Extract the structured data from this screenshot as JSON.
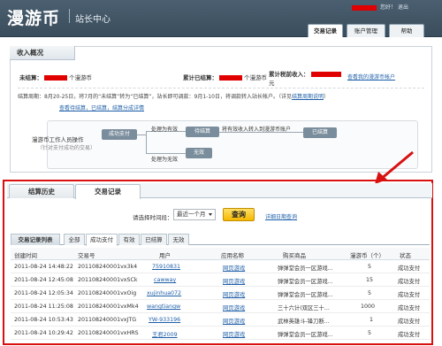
{
  "header": {
    "logo": "漫游币",
    "subtitle": "站长中心",
    "user_greeting": "您好！",
    "exit": "退出",
    "nav": [
      {
        "label": "交易记录",
        "active": true
      },
      {
        "label": "账户管理",
        "active": false
      },
      {
        "label": "帮助",
        "active": false
      }
    ]
  },
  "earnings": {
    "panel_title": "收入概况",
    "unsettled_label": "未结算：",
    "unsettled_unit": "个漫游币",
    "total_settled_label": "累计已结算：",
    "total_settled_unit": "个漫游币",
    "pretax_label": "累计税前收入：",
    "pretax_unit": "元",
    "my_account_link": "查看我的漫游币帐户",
    "note_line1": "结算周期：8月20-25日，将7月的“未结算”转为“已结算”，站长即可调款：9月1-10日，将调款转入站长帐户。（详见",
    "note_link1": "结算周期说明",
    "note_line1_end": "）",
    "note_link2": "查看待结算，已结算，结算分成详情"
  },
  "flow": {
    "operator_label": "漫游币工作人员操作",
    "operator_sub": "（针对支付成功的交易）",
    "box_success": "成功支付",
    "box_pending": "待结算",
    "box_settled": "已结算",
    "box_invalid": "无效",
    "text_valid": "处理为有效",
    "text_invalid": "处理为无效",
    "text_transfer": "将有效收入转入到漫游币账户"
  },
  "lower_tabs": [
    {
      "label": "结算历史",
      "active": false
    },
    {
      "label": "交易记录",
      "active": true
    }
  ],
  "filter": {
    "label": "请选择时间段：",
    "selected": "最近一个月",
    "query_button": "查询",
    "detail_link": "详细日期查询"
  },
  "list": {
    "title": "交易记录列表",
    "tabs": [
      {
        "label": "全部",
        "active": false
      },
      {
        "label": "成功支付",
        "active": true
      },
      {
        "label": "有效",
        "active": false
      },
      {
        "label": "已结算",
        "active": false
      },
      {
        "label": "无效",
        "active": false
      }
    ],
    "columns": [
      "创建时间",
      "交易号",
      "用户",
      "应用名称",
      "购买商品",
      "漫游币（个）",
      "状态"
    ],
    "rows": [
      {
        "time": "2011-08-24 14:48:22",
        "txn": "201108240001vx3k4",
        "user": "75910831",
        "app": "网页游戏",
        "item": "弹弹堂会员一区游戏...",
        "coins": "5",
        "status": "成功支付"
      },
      {
        "time": "2011-08-24 12:45:08",
        "txn": "201108240001vxSCk",
        "user": "cawway",
        "app": "网页游戏",
        "item": "弹弹堂会员一区游戏...",
        "coins": "15",
        "status": "成功支付"
      },
      {
        "time": "2011-08-24 12:05:34",
        "txn": "201108240001vxOig",
        "user": "xujinhua072",
        "app": "网页游戏",
        "item": "弹弹堂会员一区游戏...",
        "coins": "5",
        "status": "成功支付"
      },
      {
        "time": "2011-08-24 11:25:08",
        "txn": "201108240001vxMk4",
        "user": "wangtiangw",
        "app": "网页游戏",
        "item": "三十六计(双区三十...",
        "coins": "1000",
        "status": "成功支付"
      },
      {
        "time": "2011-08-24 10:53:43",
        "txn": "201108240001vxJTG",
        "user": "YW-933196",
        "app": "网页游戏",
        "item": "武林英雄斗-锋刀断...",
        "coins": "1",
        "status": "成功支付"
      },
      {
        "time": "2011-08-24 10:29:42",
        "txn": "201108240001vxHRS",
        "user": "王君2009",
        "app": "网页游戏",
        "item": "弹弹堂会员一区游戏...",
        "coins": "5",
        "status": "成功支付"
      }
    ]
  },
  "colors": {
    "header_bg": "#4a5f70",
    "highlight_border": "#d81010",
    "link": "#1e5fa8",
    "query_button": "#f5b800",
    "flow_box": "#7a8d9c"
  }
}
